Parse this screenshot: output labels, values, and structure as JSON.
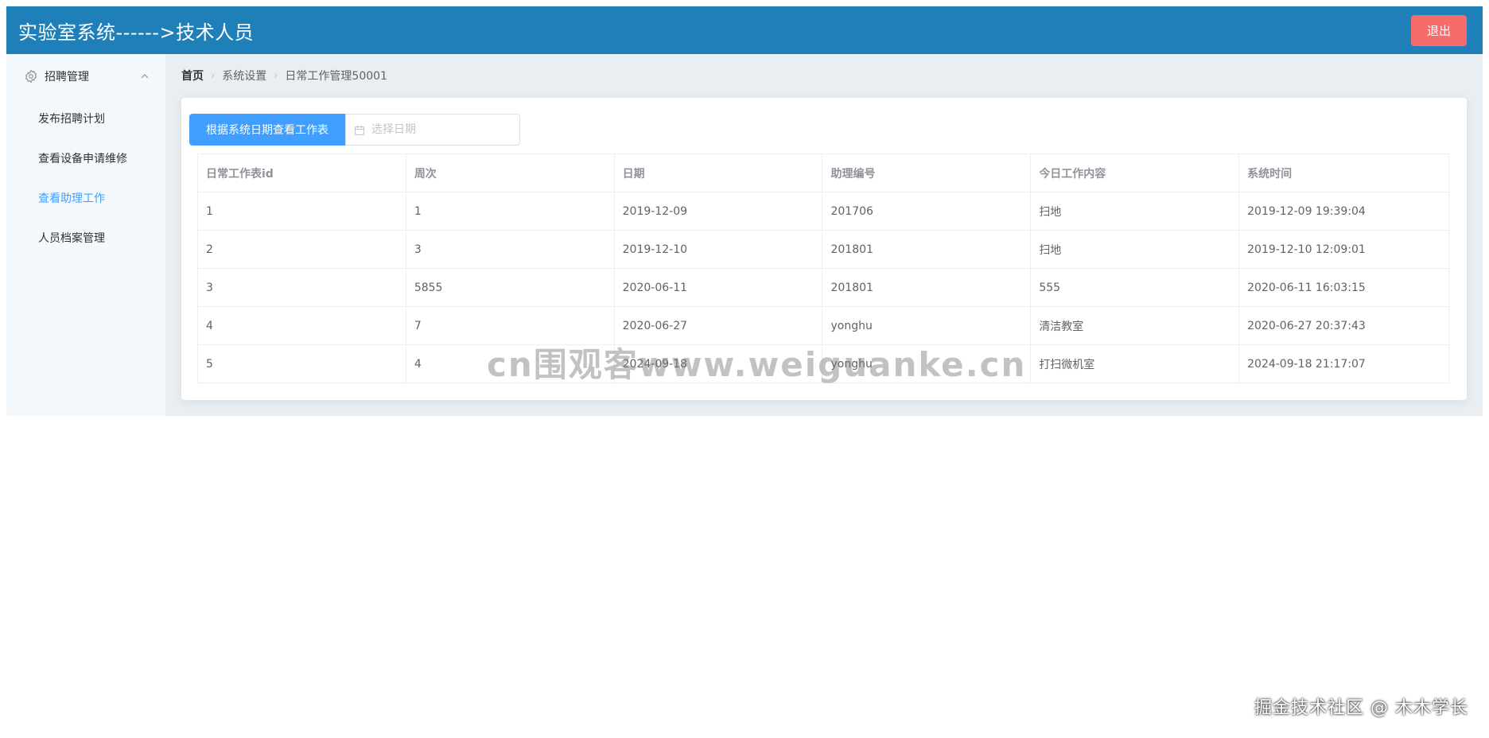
{
  "header": {
    "title": "实验室系统------>技术人员",
    "logout_label": "退出"
  },
  "sidebar": {
    "submenu": {
      "title": "招聘管理",
      "icon": "gear-icon",
      "expanded": true
    },
    "items": [
      {
        "label": "发布招聘计划",
        "active": false
      },
      {
        "label": "查看设备申请维修",
        "active": false
      },
      {
        "label": "查看助理工作",
        "active": true
      },
      {
        "label": "人员档案管理",
        "active": false
      }
    ]
  },
  "breadcrumb": [
    "首页",
    "系统设置",
    "日常工作管理50001"
  ],
  "toolbar": {
    "query_button_label": "根据系统日期查看工作表",
    "date_placeholder": "选择日期",
    "date_value": ""
  },
  "table": {
    "columns": [
      "日常工作表id",
      "周次",
      "日期",
      "助理编号",
      "今日工作内容",
      "系统时间"
    ],
    "rows": [
      [
        "1",
        "1",
        "2019-12-09",
        "201706",
        "扫地",
        "2019-12-09 19:39:04"
      ],
      [
        "2",
        "3",
        "2019-12-10",
        "201801",
        "扫地",
        "2019-12-10 12:09:01"
      ],
      [
        "3",
        "5855",
        "2020-06-11",
        "201801",
        "555",
        "2020-06-11 16:03:15"
      ],
      [
        "4",
        "7",
        "2020-06-27",
        "yonghu",
        "清洁教室",
        "2020-06-27 20:37:43"
      ],
      [
        "5",
        "4",
        "2024-09-18",
        "yonghu",
        "打扫微机室",
        "2024-09-18 21:17:07"
      ]
    ]
  },
  "watermarks": {
    "center": "cn围观客www.weiguanke.cn",
    "bottom_right": "掘金技术社区 @ 木木学长"
  },
  "colors": {
    "header_bg": "#1f7fb8",
    "logout_bg": "#f56c6c",
    "primary": "#409eff",
    "sidebar_bg": "#f3f8fd",
    "main_bg": "#e9eef3"
  }
}
